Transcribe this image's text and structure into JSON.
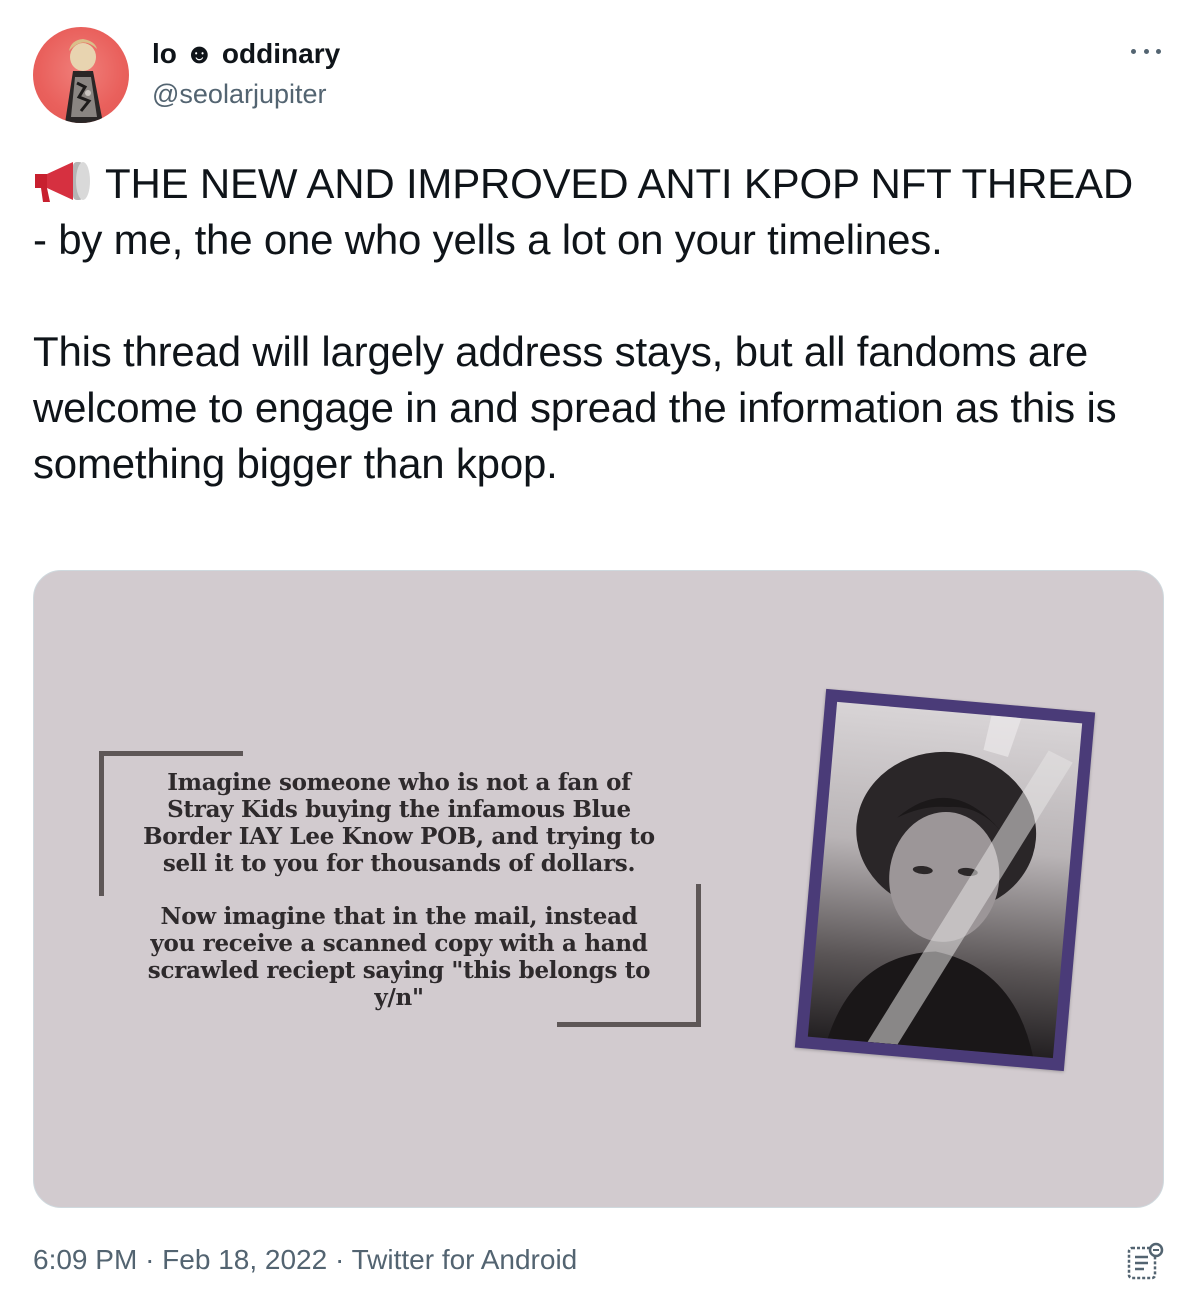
{
  "author": {
    "name_part1": "lo",
    "name_emoji": "☻",
    "name_part2": "oddinary",
    "handle": "@seolarjupiter"
  },
  "tweet": {
    "text": "THE NEW AND IMPROVED ANTI KPOP NFT THREAD - by me, the one who yells a lot on your timelines.\n\nThis thread will largely address stays, but all fandoms are welcome to engage in and spread the information as this is something bigger than kpop.",
    "icon": "megaphone-icon"
  },
  "media": {
    "paragraph1": "Imagine someone who is not a fan of\nStray Kids buying the infamous Blue\nBorder IAY Lee Know POB, and trying to\nsell it to you for thousands of dollars.",
    "paragraph2": "Now imagine that in the mail, instead\nyou receive a scanned copy with a hand\nscrawled reciept saying \"this belongs to\ny/n\"",
    "background_color": "#d2cbcf",
    "photocard_border_color": "#4a3b78"
  },
  "meta": {
    "time": "6:09 PM",
    "separator": "·",
    "date": "Feb 18, 2022",
    "source": "Twitter for Android"
  },
  "colors": {
    "text_primary": "#0f1419",
    "text_secondary": "#536471",
    "border": "#cfd9de"
  }
}
